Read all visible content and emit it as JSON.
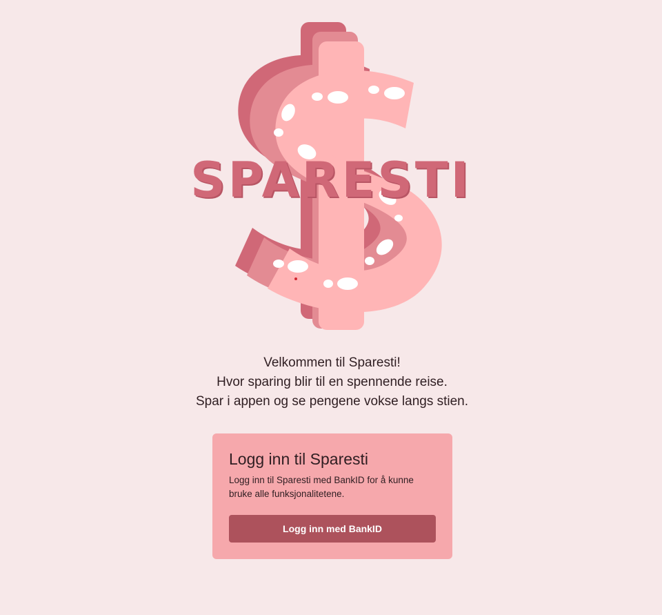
{
  "logo": {
    "icon": "dollar-path-icon",
    "wordmark": "SPARESTI",
    "colors": {
      "light": "#ffb5b6",
      "mid": "#e38b93",
      "dark": "#d06877",
      "footprints": "#ffffff"
    }
  },
  "welcome": {
    "line1": "Velkommen til Sparesti!",
    "line2": "Hvor sparing blir til en spennende reise.",
    "line3": "Spar i appen og se pengene vokse langs stien."
  },
  "login": {
    "title": "Logg inn til Sparesti",
    "description": "Logg inn til Sparesti med BankID for å kunne bruke alle funksjonalitetene.",
    "button_label": "Logg inn med BankID"
  },
  "colors": {
    "background": "#f7e8e9",
    "card": "#f6a8ac",
    "button": "#ad525c",
    "text": "#2f1e22"
  }
}
